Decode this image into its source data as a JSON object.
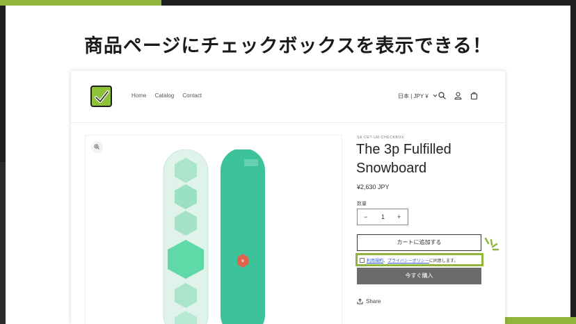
{
  "banner": {
    "headline": "商品ページにチェックボックスを表示できる！"
  },
  "colors": {
    "accent": "#8fb53a",
    "dark": "#1f1f1f",
    "logo_bg": "#8fc13b",
    "buy_button": "#6b6b6b",
    "link": "#2b55c9",
    "board_left": "#dff3ea",
    "board_right": "#3cc39a"
  },
  "header": {
    "nav": [
      "Home",
      "Catalog",
      "Contact"
    ],
    "locale": "日本 | JPY ¥",
    "icons": [
      "search-icon",
      "account-icon",
      "cart-icon"
    ]
  },
  "product": {
    "vendor": "SA-OET-UR-CHECKBOX",
    "title": "The 3p Fulfilled Snowboard",
    "price": "¥2,630 JPY",
    "quantity_label": "数量",
    "quantity_value": "1",
    "minus": "−",
    "plus": "+",
    "add_to_cart": "カートに追加する",
    "agreement": {
      "terms_link": "利用規約",
      "separator": "、",
      "privacy_link": "プライバシーポリシー",
      "suffix": "に同意します。"
    },
    "buy_now": "今すぐ購入",
    "share": "Share"
  }
}
